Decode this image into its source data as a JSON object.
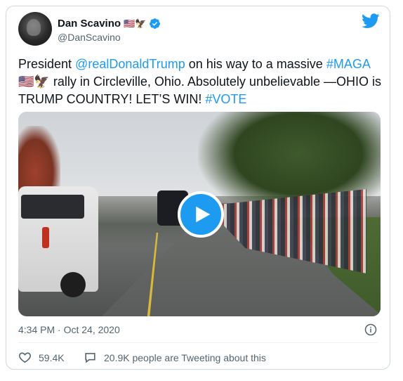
{
  "author": {
    "name": "Dan Scavino",
    "name_emoji": "🇺🇸🦅",
    "handle": "@DanScavino"
  },
  "tweet": {
    "parts": [
      {
        "text": "President ",
        "link": false
      },
      {
        "text": "@realDonaldTrump",
        "link": true
      },
      {
        "text": " on his way to a massive ",
        "link": false
      },
      {
        "text": "#MAGA",
        "link": true
      },
      {
        "text": "🇺🇸🦅",
        "link": false
      },
      {
        "text": " rally in Circleville, Ohio. Absolutely unbelievable —OHIO is TRUMP COUNTRY! LET’S WIN! ",
        "link": false
      },
      {
        "text": "#VOTE",
        "link": true
      }
    ]
  },
  "timestamp": "4:34 PM · Oct 24, 2020",
  "likes": "59.4K",
  "tweeting": "20.9K people are Tweeting about this",
  "colors": {
    "accent": "#1d9bf0",
    "text": "#0f1419",
    "muted": "#536471"
  },
  "icons": {
    "verified": "verified-badge-icon",
    "brand": "twitter-bird-icon",
    "play": "play-icon",
    "info": "info-icon",
    "like": "heart-icon",
    "reply": "speech-bubble-icon"
  }
}
